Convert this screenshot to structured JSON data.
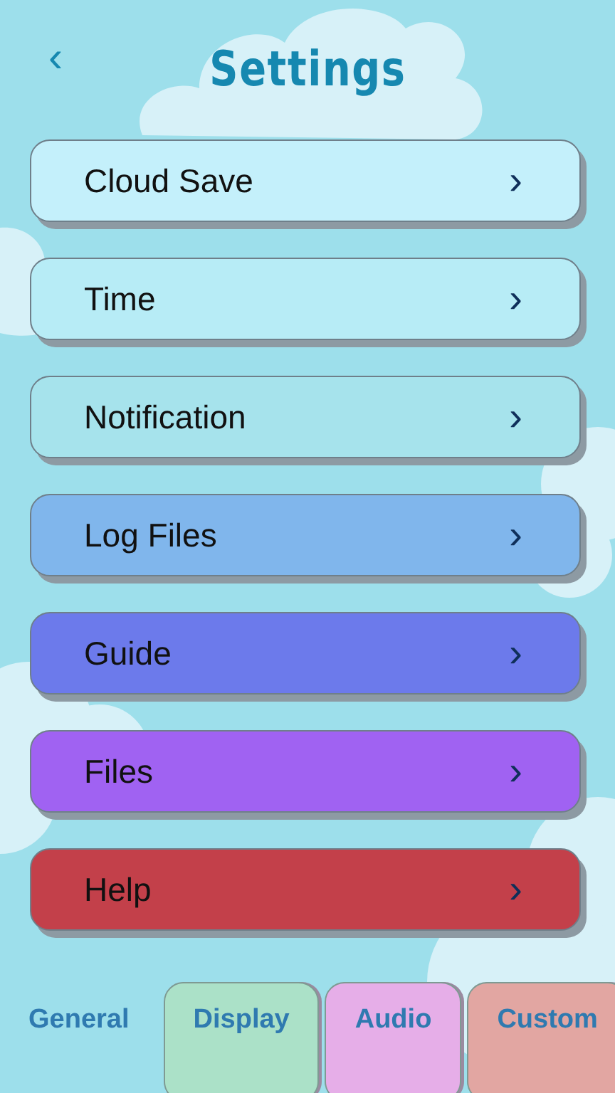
{
  "header": {
    "back": "‹",
    "title": "Settings"
  },
  "menu": [
    {
      "label": "Cloud Save",
      "color": "#c4f0fb",
      "chevron": "›"
    },
    {
      "label": "Time",
      "color": "#b7ecf6",
      "chevron": "›"
    },
    {
      "label": "Notification",
      "color": "#a6e3ec",
      "chevron": "›"
    },
    {
      "label": "Log Files",
      "color": "#80b6ec",
      "chevron": "›"
    },
    {
      "label": "Guide",
      "color": "#6c7aeb",
      "chevron": "›"
    },
    {
      "label": "Files",
      "color": "#a062f2",
      "chevron": "›"
    },
    {
      "label": "Help",
      "color": "#c3404a",
      "chevron": "›"
    }
  ],
  "tabs": [
    {
      "label": "General",
      "selected": true,
      "color": "#9ddfeb"
    },
    {
      "label": "Display",
      "selected": false,
      "color": "#abe1c8"
    },
    {
      "label": "Audio",
      "selected": false,
      "color": "#e6aee8"
    },
    {
      "label": "Custom",
      "selected": false,
      "color": "#e2a6a2"
    }
  ]
}
